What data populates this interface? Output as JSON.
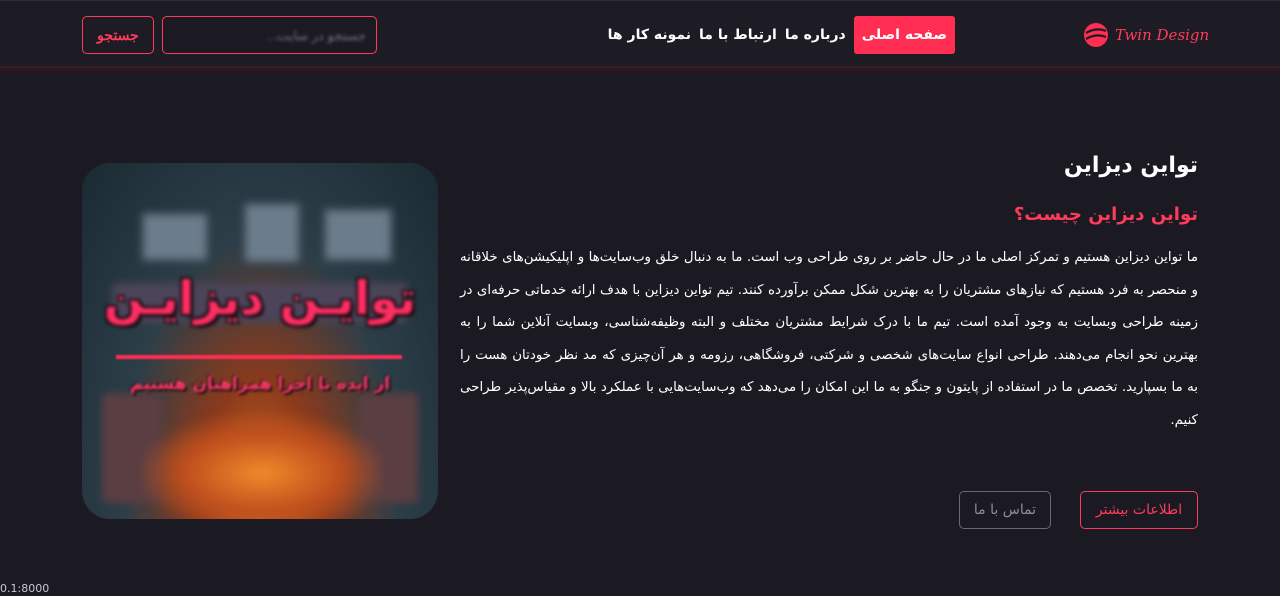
{
  "brand": {
    "name": "Twin Design",
    "accent": "#ff3b5c"
  },
  "nav": {
    "items": [
      {
        "label": "صفحه اصلی",
        "active": true
      },
      {
        "label": "درباره ما",
        "active": false
      },
      {
        "label": "ارتباط با ما",
        "active": false
      },
      {
        "label": "نمونه کار ها",
        "active": false
      }
    ]
  },
  "search": {
    "placeholder": "جستجو در سایت...",
    "button_label": "جستجو"
  },
  "hero_image": {
    "title": "توایـن دیزایـن",
    "subtitle": "از ایده تا اجرا همراهتان هستیم"
  },
  "main": {
    "title": "تواین دیزاین",
    "subtitle": "تواین دیزاین چیست؟",
    "description": "ما تواین دیزاین هستیم و تمرکز اصلی ما در حال حاضر بر روی طراحی وب است. ما به دنبال خلق وب‌سایت‌ها و اپلیکیشن‌های خلاقانه و منحصر به فرد هستیم که نیازهای مشتریان را به بهترین شکل ممکن برآورده کنند. تیم تواین دیزاین با هدف ارائه خدماتی حرفه‌ای در زمینه طراحی وبسایت به وجود آمده است. تیم ما با درک شرایط مشتریان مختلف و البته وظیفه‌شناسی، وبسایت آنلاین شما را به بهترین نحو انجام می‌دهند. طراحی انواع سایت‌های شخصی و شرکتی، فروشگاهی، رزومه و هر آن‌چیزی که مد نظر خودتان هست را به ما بسپارید. تخصص ما در استفاده از پایتون و جنگو به ما این امکان را می‌دهد که وب‌سایت‌هایی با عملکرد بالا و مقیاس‌پذیر طراحی کنیم.",
    "more_button": "اطلاعات بیشتر",
    "contact_button": "تماس با ما"
  },
  "status_bar": {
    "url": "0.1:8000"
  }
}
